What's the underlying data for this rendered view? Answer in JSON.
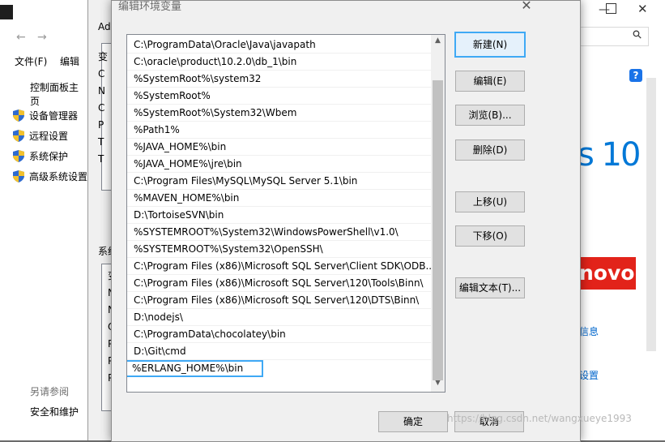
{
  "dialog": {
    "title": "编辑环境变量",
    "close_glyph": "✕",
    "paths": [
      "C:\\ProgramData\\Oracle\\Java\\javapath",
      "C:\\oracle\\product\\10.2.0\\db_1\\bin",
      "%SystemRoot%\\system32",
      "%SystemRoot%",
      "%SystemRoot%\\System32\\Wbem",
      "%Path1%",
      "%JAVA_HOME%\\bin",
      "%JAVA_HOME%\\jre\\bin",
      "C:\\Program Files\\MySQL\\MySQL Server 5.1\\bin",
      "%MAVEN_HOME%\\bin",
      "D:\\TortoiseSVN\\bin",
      "%SYSTEMROOT%\\System32\\WindowsPowerShell\\v1.0\\",
      "%SYSTEMROOT%\\System32\\OpenSSH\\",
      "C:\\Program Files (x86)\\Microsoft SQL Server\\Client SDK\\ODB...",
      "C:\\Program Files (x86)\\Microsoft SQL Server\\120\\Tools\\Binn\\",
      "C:\\Program Files (x86)\\Microsoft SQL Server\\120\\DTS\\Binn\\",
      "D:\\nodejs\\",
      "C:\\ProgramData\\chocolatey\\bin",
      "D:\\Git\\cmd"
    ],
    "editing_value": "%ERLANG_HOME%\\bin",
    "buttons": {
      "new": "新建(N)",
      "edit": "编辑(E)",
      "browse": "浏览(B)...",
      "delete": "删除(D)",
      "move_up": "上移(U)",
      "move_down": "下移(O)",
      "edit_text": "编辑文本(T)...",
      "ok": "确定",
      "cancel": "取消"
    }
  },
  "background": {
    "menu_file": "文件(F)",
    "menu_edit": "编辑",
    "control_panel_home": "控制面板主页",
    "links": [
      "设备管理器",
      "远程设置",
      "系统保护",
      "高级系统设置"
    ],
    "see_also": "另请参阅",
    "security": "安全和维护",
    "sysprop_group1": "Ad",
    "sysprop_group2": "系统",
    "win10_text": "s 10",
    "lenovo_text": "novo",
    "info_link": "信息",
    "settings_link": "设置",
    "help_glyph": "?",
    "search_glyph": "⚲",
    "list_letters_top": [
      "变",
      "C",
      "N",
      "C",
      "P",
      "T",
      "T"
    ],
    "list_letters_bottom": [
      "变",
      "N",
      "N",
      "O",
      "P",
      "P",
      "P"
    ]
  },
  "watermark": "https://blog.csdn.net/wangxueye1993",
  "colors": {
    "focus": "#3fa9f5",
    "lenovo": "#e2231a",
    "win10": "#0078d7"
  }
}
